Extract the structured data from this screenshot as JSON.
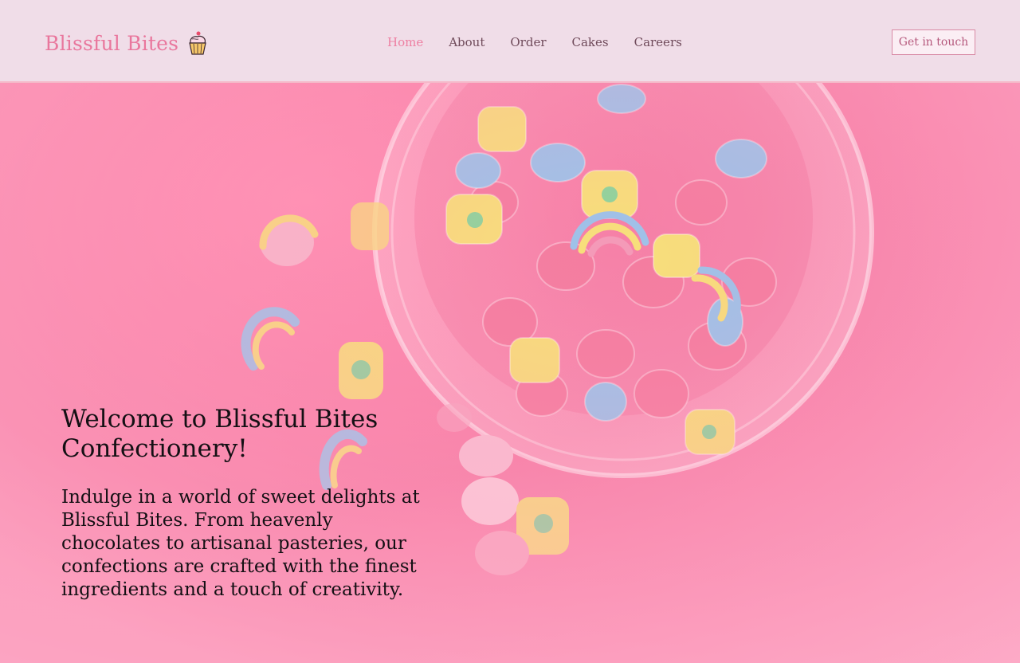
{
  "brand": {
    "name": "Blissful Bites",
    "icon": "cupcake-icon"
  },
  "nav": {
    "items": [
      {
        "label": "Home",
        "active": true
      },
      {
        "label": "About",
        "active": false
      },
      {
        "label": "Order",
        "active": false
      },
      {
        "label": "Cakes",
        "active": false
      },
      {
        "label": "Careers",
        "active": false
      }
    ]
  },
  "cta": {
    "label": "Get in touch"
  },
  "hero": {
    "title": "Welcome to Blissful Bites Confectionery!",
    "body": "Indulge in a world of sweet delights at Blissful Bites. From heavenly chocolates to artisanal pasteries, our confections are crafted with the finest ingredients and a touch of creativity.",
    "image": "marshmallow-bowl-photo"
  },
  "colors": {
    "header_bg": "#f0dde8",
    "brand": "#e9779d",
    "nav_active": "#ee7fa2",
    "nav_text": "#6f4a5a",
    "hero_bg": "#f67ea6"
  }
}
